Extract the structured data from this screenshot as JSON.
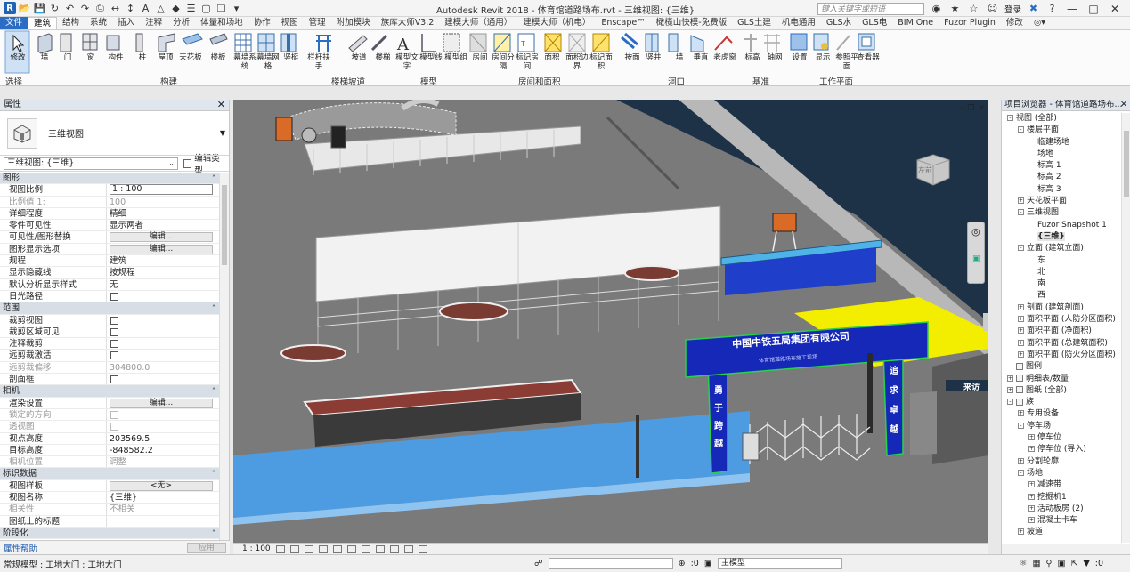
{
  "app": {
    "title": "Autodesk Revit 2018 -   体育馆道路场布.rvt - 三维视图: {三维}",
    "search_placeholder": "键入关键字或短语",
    "login": "登录"
  },
  "tabs": [
    "文件",
    "建筑",
    "结构",
    "系统",
    "插入",
    "注释",
    "分析",
    "体量和场地",
    "协作",
    "视图",
    "管理",
    "附加模块",
    "族库大师V3.2",
    "建模大师（通用）",
    "建模大师（机电）",
    "Enscape™",
    "橄榄山快模-免费版",
    "GLS土建",
    "机电通用",
    "GLS水",
    "GLS电",
    "BIM One",
    "Fuzor Plugin",
    "修改"
  ],
  "active_tab": "建筑",
  "ribbon": {
    "tools": [
      "修改",
      "墙",
      "门",
      "窗",
      "构件",
      "柱",
      "屋顶",
      "天花板",
      "楼板",
      "幕墙系统",
      "幕墙网格",
      "竖梃",
      "栏杆扶手",
      "坡道",
      "楼梯",
      "模型文字",
      "模型线",
      "模型组",
      "房间",
      "房间分隔",
      "标记房间",
      "面积",
      "面积边界",
      "标记面积",
      "按面",
      "竖井",
      "墙",
      "垂直",
      "老虎窗",
      "标高",
      "轴网",
      "设置",
      "显示",
      "参照平面",
      "查看器"
    ],
    "panels": [
      "选择",
      "构建",
      "楼梯坡道",
      "模型",
      "房间和面积",
      "洞口",
      "基准",
      "工作平面"
    ]
  },
  "properties": {
    "header": "属性",
    "type_name": "三维视图",
    "filter": "三维视图: {三维}",
    "edit_type": "编辑类型",
    "sections": [
      {
        "title": "图形",
        "rows": [
          {
            "name": "视图比例",
            "value": "1 : 100",
            "kind": "input"
          },
          {
            "name": "比例值 1:",
            "value": "100",
            "kind": "dim"
          },
          {
            "name": "详细程度",
            "value": "精细",
            "kind": "text"
          },
          {
            "name": "零件可见性",
            "value": "显示两者",
            "kind": "text"
          },
          {
            "name": "可见性/图形替换",
            "value": "编辑...",
            "kind": "button"
          },
          {
            "name": "图形显示选项",
            "value": "编辑...",
            "kind": "button"
          },
          {
            "name": "规程",
            "value": "建筑",
            "kind": "text"
          },
          {
            "name": "显示隐藏线",
            "value": "按规程",
            "kind": "text"
          },
          {
            "name": "默认分析显示样式",
            "value": "无",
            "kind": "text"
          },
          {
            "name": "日光路径",
            "value": "",
            "kind": "check"
          }
        ]
      },
      {
        "title": "范围",
        "rows": [
          {
            "name": "裁剪视图",
            "value": "",
            "kind": "check"
          },
          {
            "name": "裁剪区域可见",
            "value": "",
            "kind": "check"
          },
          {
            "name": "注释裁剪",
            "value": "",
            "kind": "check"
          },
          {
            "name": "远剪裁激活",
            "value": "",
            "kind": "check"
          },
          {
            "name": "远剪裁偏移",
            "value": "304800.0",
            "kind": "dim"
          },
          {
            "name": "剖面框",
            "value": "",
            "kind": "check"
          }
        ]
      },
      {
        "title": "相机",
        "rows": [
          {
            "name": "渲染设置",
            "value": "编辑...",
            "kind": "button"
          },
          {
            "name": "锁定的方向",
            "value": "",
            "kind": "checkdim"
          },
          {
            "name": "透视图",
            "value": "",
            "kind": "checkdim"
          },
          {
            "name": "视点高度",
            "value": "203569.5",
            "kind": "text"
          },
          {
            "name": "目标高度",
            "value": "-848582.2",
            "kind": "text"
          },
          {
            "name": "相机位置",
            "value": "调整",
            "kind": "dim"
          }
        ]
      },
      {
        "title": "标识数据",
        "rows": [
          {
            "name": "视图样板",
            "value": "<无>",
            "kind": "button"
          },
          {
            "name": "视图名称",
            "value": "{三维}",
            "kind": "text"
          },
          {
            "name": "相关性",
            "value": "不相关",
            "kind": "dim"
          },
          {
            "name": "图纸上的标题",
            "value": "",
            "kind": "text"
          }
        ]
      },
      {
        "title": "阶段化",
        "rows": []
      }
    ],
    "help": "属性帮助",
    "apply": "应用"
  },
  "viewport": {
    "gate_title": "中国中铁五局集团有限公司",
    "gate_subtitle": "体育馆道路场布施工现场",
    "gate_left": "勇于跨越",
    "gate_right": "追求卓越",
    "visitor_sign": "来访",
    "viewcube": "左前"
  },
  "view_bar": {
    "scale": "1 : 100"
  },
  "browser": {
    "header": "项目浏览器 - 体育馆道路场布...",
    "items": [
      {
        "label": "视图 (全部)",
        "level": 0,
        "exp": "-"
      },
      {
        "label": "楼层平面",
        "level": 1,
        "exp": "-"
      },
      {
        "label": "临建场地",
        "level": 2,
        "exp": ""
      },
      {
        "label": "场地",
        "level": 2,
        "exp": ""
      },
      {
        "label": "标高 1",
        "level": 2,
        "exp": ""
      },
      {
        "label": "标高 2",
        "level": 2,
        "exp": ""
      },
      {
        "label": "标高 3",
        "level": 2,
        "exp": ""
      },
      {
        "label": "天花板平面",
        "level": 1,
        "exp": "+"
      },
      {
        "label": "三维视图",
        "level": 1,
        "exp": "-"
      },
      {
        "label": "Fuzor Snapshot 1",
        "level": 2,
        "exp": ""
      },
      {
        "label": "{三维}",
        "level": 2,
        "exp": "",
        "selected": true
      },
      {
        "label": "立面 (建筑立面)",
        "level": 1,
        "exp": "-"
      },
      {
        "label": "东",
        "level": 2,
        "exp": ""
      },
      {
        "label": "北",
        "level": 2,
        "exp": ""
      },
      {
        "label": "南",
        "level": 2,
        "exp": ""
      },
      {
        "label": "西",
        "level": 2,
        "exp": ""
      },
      {
        "label": "剖面 (建筑剖面)",
        "level": 1,
        "exp": "+"
      },
      {
        "label": "面积平面 (人防分区面积)",
        "level": 1,
        "exp": "+"
      },
      {
        "label": "面积平面 (净面积)",
        "level": 1,
        "exp": "+"
      },
      {
        "label": "面积平面 (总建筑面积)",
        "level": 1,
        "exp": "+"
      },
      {
        "label": "面积平面 (防火分区面积)",
        "level": 1,
        "exp": "+"
      },
      {
        "label": "图例",
        "level": 0,
        "exp": "",
        "icon": true
      },
      {
        "label": "明细表/数量",
        "level": 0,
        "exp": "+",
        "icon": true
      },
      {
        "label": "图纸 (全部)",
        "level": 0,
        "exp": "+",
        "icon": true
      },
      {
        "label": "族",
        "level": 0,
        "exp": "-",
        "icon": true
      },
      {
        "label": "专用设备",
        "level": 1,
        "exp": "+"
      },
      {
        "label": "停车场",
        "level": 1,
        "exp": "-"
      },
      {
        "label": "停车位",
        "level": 2,
        "exp": "+"
      },
      {
        "label": "停车位 (导入)",
        "level": 2,
        "exp": "+"
      },
      {
        "label": "分割轮廓",
        "level": 1,
        "exp": "+"
      },
      {
        "label": "场地",
        "level": 1,
        "exp": "-"
      },
      {
        "label": "减速带",
        "level": 2,
        "exp": "+"
      },
      {
        "label": "挖掘机1",
        "level": 2,
        "exp": "+"
      },
      {
        "label": "活动板房 (2)",
        "level": 2,
        "exp": "+"
      },
      {
        "label": "混凝土卡车",
        "level": 2,
        "exp": "+"
      },
      {
        "label": "坡道",
        "level": 1,
        "exp": "+"
      }
    ]
  },
  "status": {
    "left": "常规模型 : 工地大门 : 工地大门",
    "coord": ":0",
    "model": "主模型",
    "filter_count": ":0"
  }
}
